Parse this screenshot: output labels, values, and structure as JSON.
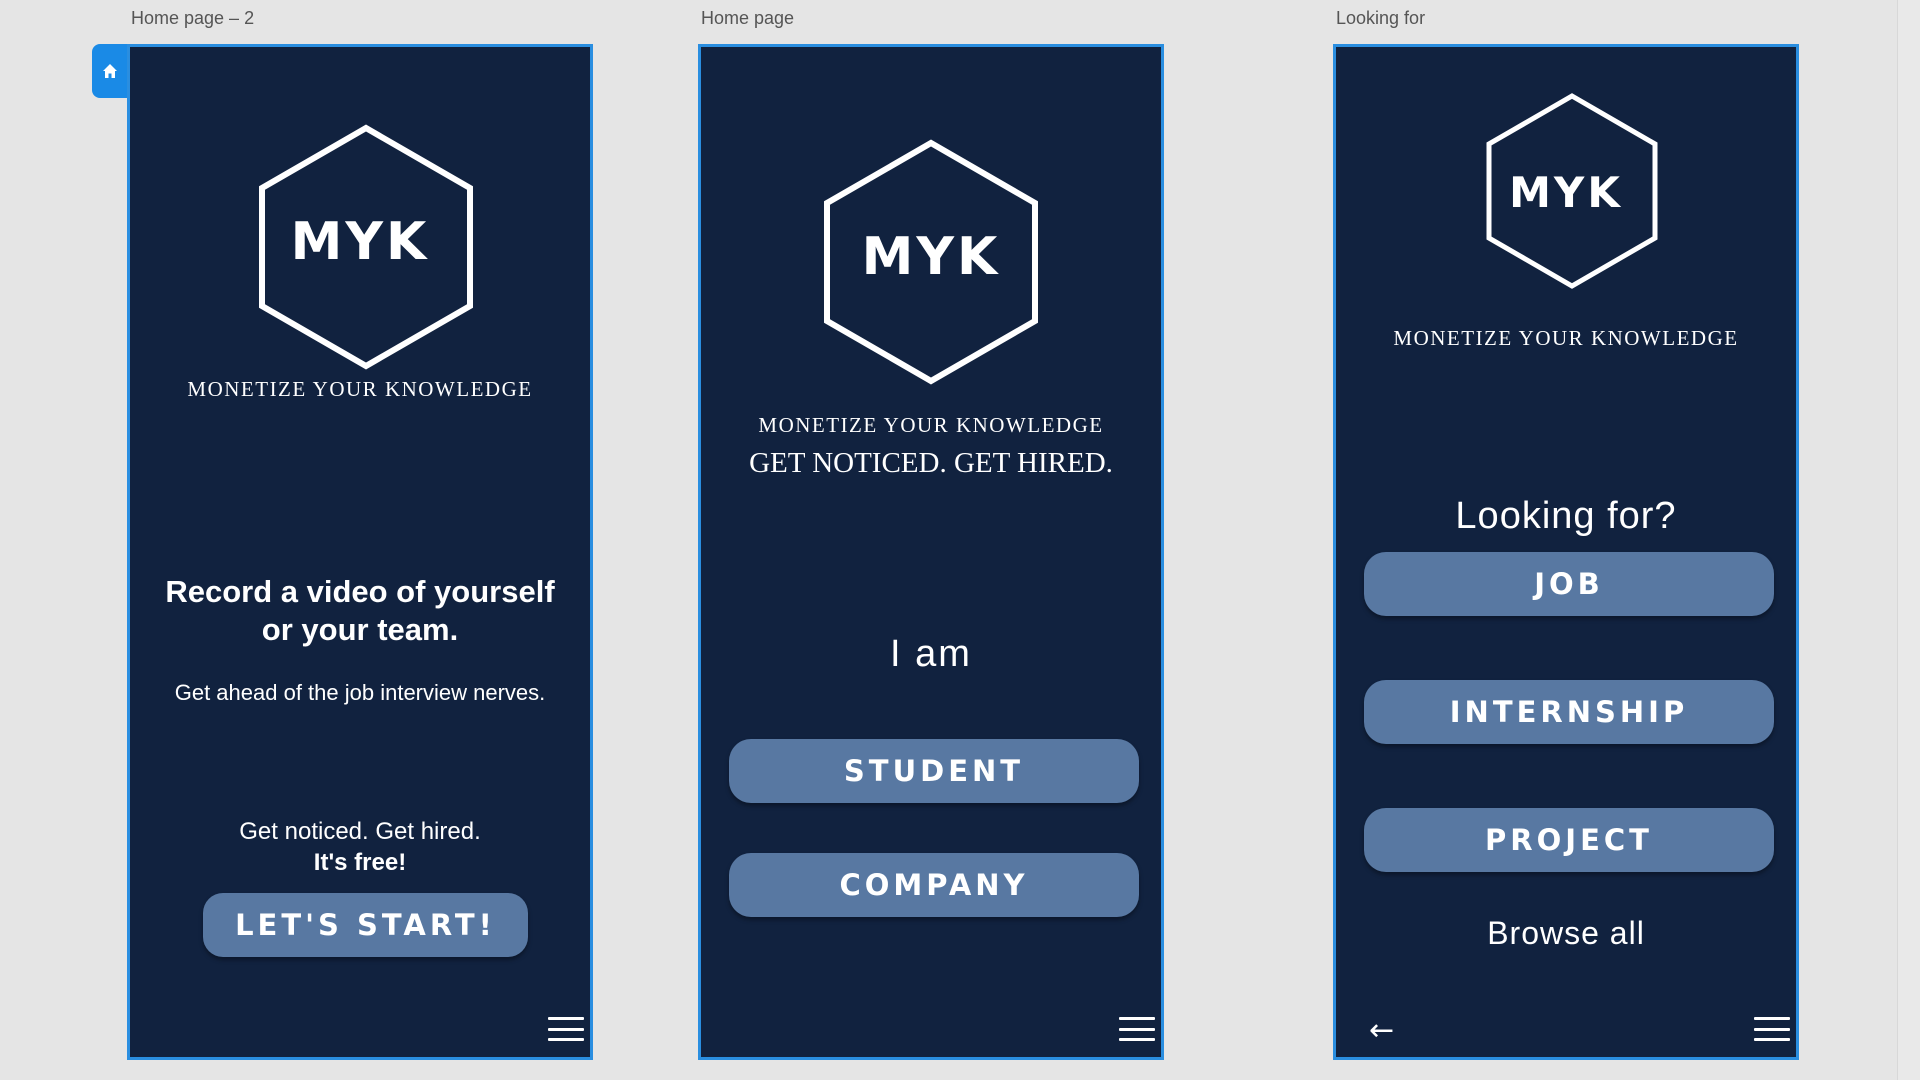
{
  "artboards": [
    {
      "label": "Home page – 2",
      "logo": "MYK",
      "tagline": "MONETIZE YOUR KNOWLEDGE",
      "headline_line1": "Record a video of yourself",
      "headline_line2": "or your team.",
      "subtext": "Get ahead of the job interview nerves.",
      "cta_line1": "Get noticed. Get hired.",
      "cta_line2": "It's free!",
      "start_button": "LET'S START!",
      "menu_icon": "hamburger-menu-icon"
    },
    {
      "label": "Home page",
      "logo": "MYK",
      "tagline": "MONETIZE YOUR KNOWLEDGE",
      "slogan": "GET NOTICED. GET HIRED.",
      "prompt": "I am",
      "options": [
        "STUDENT",
        "COMPANY"
      ],
      "menu_icon": "hamburger-menu-icon"
    },
    {
      "label": "Looking for",
      "logo": "MYK",
      "tagline": "MONETIZE YOUR KNOWLEDGE",
      "prompt": "Looking for?",
      "options": [
        "JOB",
        "INTERNSHIP",
        "PROJECT"
      ],
      "browse_all": "Browse all",
      "back_icon": "back-arrow-icon",
      "menu_icon": "hamburger-menu-icon"
    }
  ],
  "home_tab_icon": "home-icon",
  "colors": {
    "canvas": "#e5e5e5",
    "artboard_bg": "#11223f",
    "artboard_border": "#2a8ee0",
    "button_bg": "#5878a2",
    "text": "#ffffff",
    "home_tab": "#1a8ae6"
  }
}
